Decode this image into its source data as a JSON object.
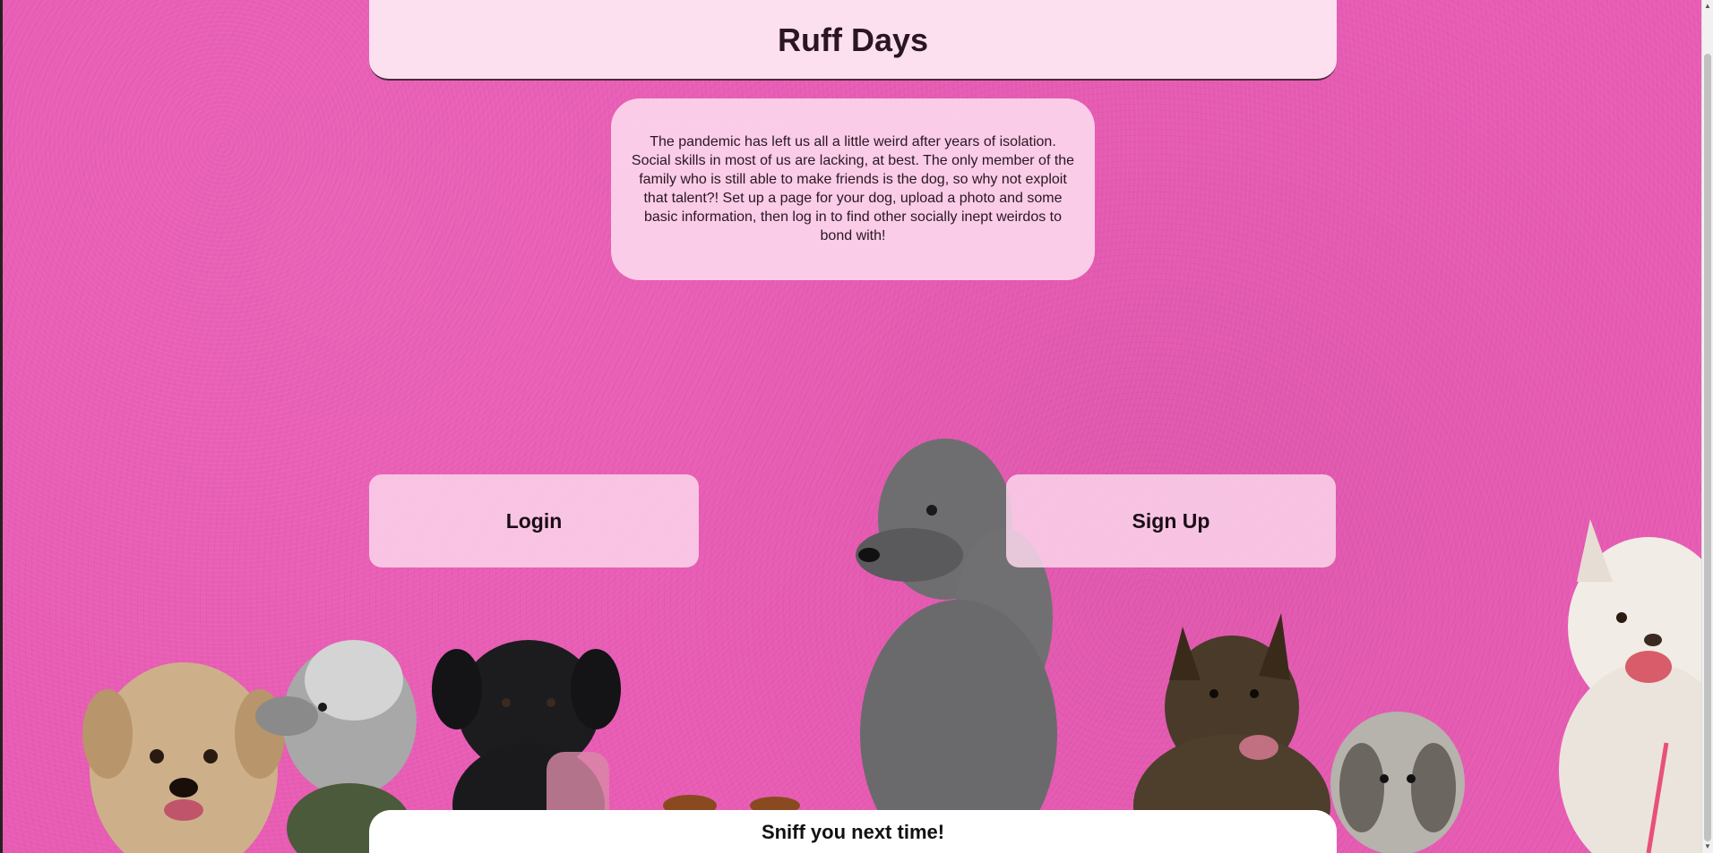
{
  "header": {
    "title": "Ruff Days"
  },
  "intro": {
    "text": "The pandemic has left us all a little weird after years of isolation. Social skills in most of us are lacking, at best. The only member of the family who is still able to make friends is the dog, so why not exploit that talent?! Set up a page for your dog, upload a photo and some basic information, then log in to find other socially inept weirdos to bond with!"
  },
  "actions": {
    "login_label": "Login",
    "signup_label": "Sign Up"
  },
  "footer": {
    "text": "Sniff you next time!"
  },
  "colors": {
    "background": "#e85cb4",
    "panel": "#fce0f0",
    "footer": "#ffffff"
  }
}
